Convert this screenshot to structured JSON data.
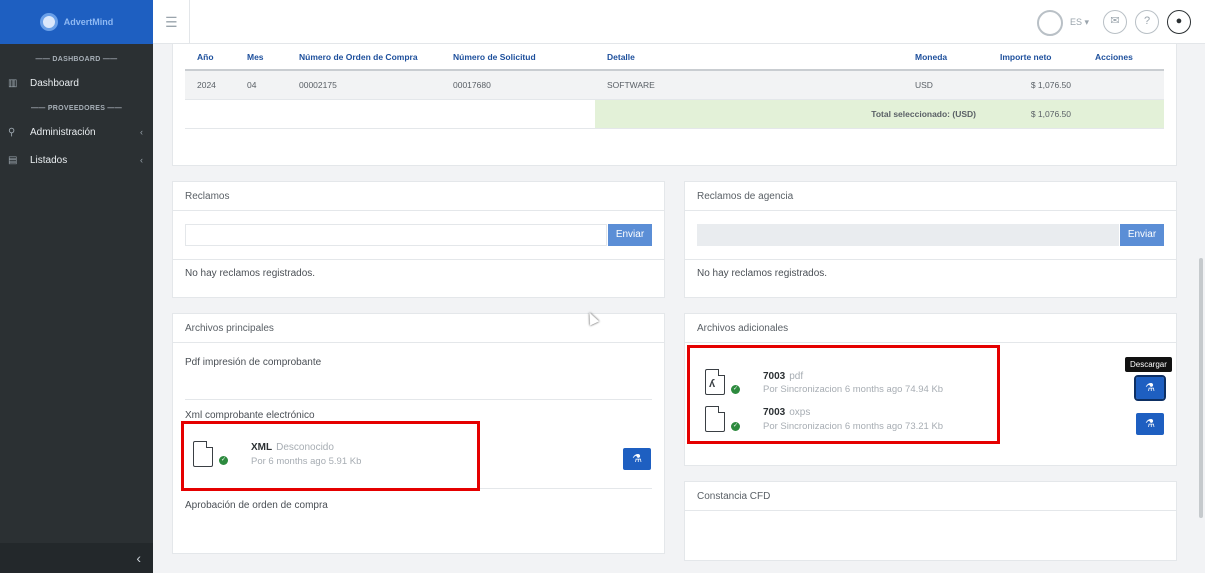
{
  "brand": {
    "name": "AdvertMind"
  },
  "sidebar": {
    "sections": [
      {
        "title": "DASHBOARD",
        "items": [
          {
            "label": "Dashboard",
            "icon": "book-icon"
          }
        ]
      },
      {
        "title": "PROVEEDORES",
        "items": [
          {
            "label": "Administración",
            "icon": "wrench-icon"
          },
          {
            "label": "Listados",
            "icon": "list-icon"
          }
        ]
      }
    ],
    "collapse_icon": "‹"
  },
  "topbar": {
    "language": "ES ▾"
  },
  "order_table": {
    "headers": [
      "Año",
      "Mes",
      "Número de Orden de Compra",
      "Número de Solicitud",
      "Detalle",
      "Moneda",
      "Importe neto",
      "Acciones"
    ],
    "rows": [
      [
        "2024",
        "04",
        "00002175",
        "00017680",
        "SOFTWARE",
        "USD",
        "$ 1,076.50",
        ""
      ]
    ],
    "total_label": "Total seleccionado: (USD)",
    "total_value": "$ 1,076.50"
  },
  "reclamos": {
    "title": "Reclamos",
    "send_label": "Enviar",
    "empty": "No hay reclamos registrados."
  },
  "reclamos_agencia": {
    "title": "Reclamos de agencia",
    "send_label": "Enviar",
    "empty": "No hay reclamos registrados."
  },
  "archivos_principales": {
    "title": "Archivos principales",
    "pdf_label": "Pdf impresión de comprobante",
    "xml_label": "Xml comprobante electrónico",
    "xml_file": {
      "name": "XML",
      "type": "Desconocido",
      "meta": "Por  6 months ago  5.91 Kb"
    },
    "aprobacion_label": "Aprobación de orden de compra"
  },
  "archivos_adicionales": {
    "title": "Archivos adicionales",
    "files": [
      {
        "name": "7003",
        "ext": "pdf",
        "meta": "Por Sincronizacion 6 months ago  74.94 Kb"
      },
      {
        "name": "7003",
        "ext": "oxps",
        "meta": "Por Sincronizacion 6 months ago  73.21 Kb"
      }
    ],
    "tooltip": "Descargar"
  },
  "constancia": {
    "title": "Constancia CFD"
  },
  "colors": {
    "brand_blue": "#1e5fc1",
    "sidebar_bg": "#2b3033",
    "total_bg": "#e3f1d8",
    "highlight_red": "#e50000"
  }
}
